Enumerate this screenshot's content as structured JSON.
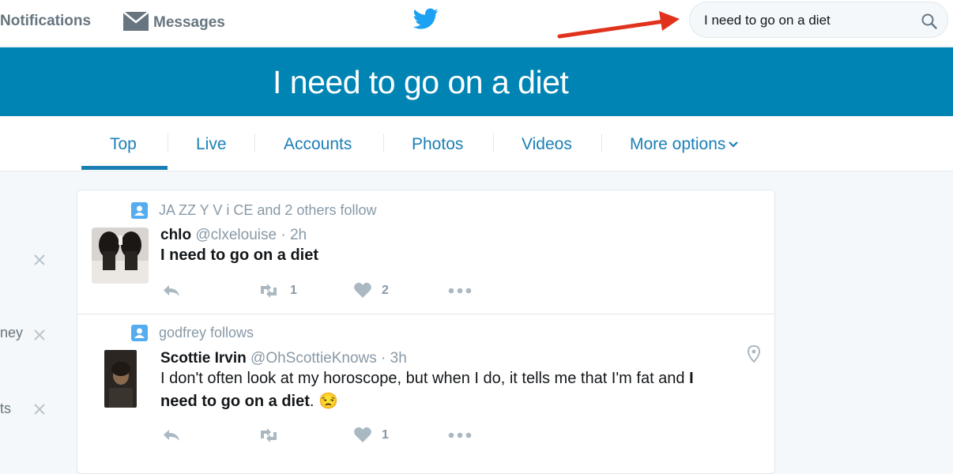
{
  "nav": {
    "notifications": "Notifications",
    "messages": "Messages"
  },
  "search": {
    "value": "I need to go on a diet"
  },
  "banner": {
    "title": "I need to go on a diet"
  },
  "tabs": [
    {
      "label": "Top"
    },
    {
      "label": "Live"
    },
    {
      "label": "Accounts"
    },
    {
      "label": "Photos"
    },
    {
      "label": "Videos"
    },
    {
      "label": "More options"
    }
  ],
  "sidebar": {
    "items": [
      {
        "label": ""
      },
      {
        "label": "ney"
      },
      {
        "label": "ts"
      }
    ]
  },
  "tweets": [
    {
      "context": "JA ZZ Y V i CE and 2 others follow",
      "name": "chlo",
      "handle": "@clxelouise · 2h",
      "text": "I need to go on a diet",
      "retweets": "1",
      "likes": "2"
    },
    {
      "context": "godfrey follows",
      "name": "Scottie Irvin",
      "handle": "@OhScottieKnows · 3h",
      "text_line1_normal": "I don't often look at my horoscope, but when I do, it tells me that I'm fat and ",
      "text_line1_bold": "I",
      "text_line2_bold": "need to go on a diet",
      "text_line2_end": ". 😒",
      "retweets": "",
      "likes": "1"
    }
  ],
  "colors": {
    "accent": "#1b7fb6",
    "banner": "#0084b4",
    "annotation_arrow": "#e0321c"
  }
}
